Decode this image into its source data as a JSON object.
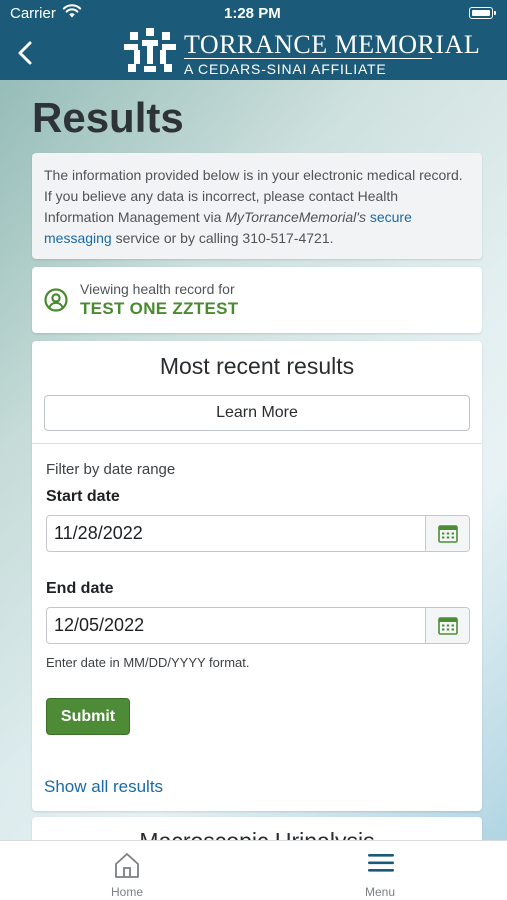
{
  "status_bar": {
    "carrier": "Carrier",
    "time": "1:28 PM"
  },
  "header": {
    "logo_title": "TORRANCE MEMORIAL",
    "logo_subtitle": "A CEDARS-SINAI AFFILIATE"
  },
  "page": {
    "title": "Results"
  },
  "notice": {
    "text_1": "The information provided below is in your electronic medical record. If you believe any data is incorrect, please contact Health Information Management via ",
    "text_italic": "MyTorranceMemorial's",
    "text_2": " ",
    "link": "secure messaging",
    "text_3": " service or by calling 310-517-4721."
  },
  "viewing": {
    "label": "Viewing health record for",
    "patient_name": "TEST ONE ZZTEST"
  },
  "results": {
    "section_title": "Most recent results",
    "learn_more_label": "Learn More",
    "filter_label": "Filter by date range",
    "start_date_label": "Start date",
    "start_date_value": "11/28/2022",
    "end_date_label": "End date",
    "end_date_value": "12/05/2022",
    "date_hint": "Enter date in MM/DD/YYYY format.",
    "submit_label": "Submit",
    "show_all_label": "Show all results"
  },
  "next_card": {
    "title": "Macroscopic Urinalysis"
  },
  "tab_bar": {
    "home_label": "Home",
    "menu_label": "Menu"
  },
  "colors": {
    "brand": "#1b5a78",
    "accent_green": "#4e8b37",
    "link": "#1a6aa6"
  }
}
